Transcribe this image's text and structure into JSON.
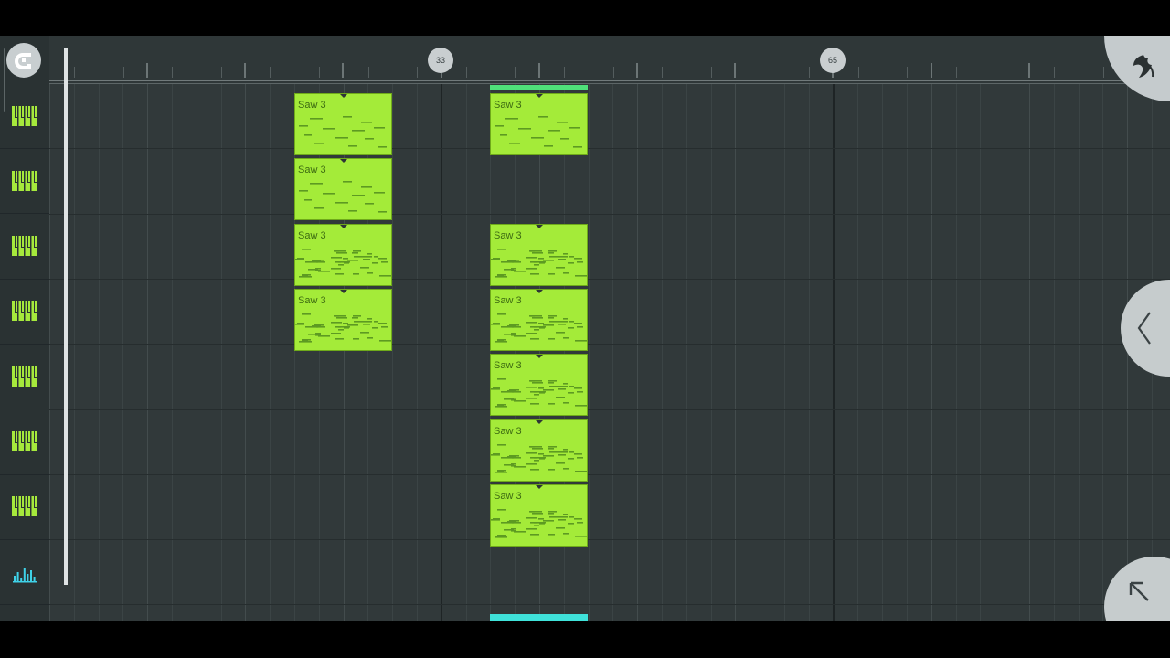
{
  "ruler": {
    "markers": [
      "33",
      "65"
    ]
  },
  "clip_label": "Saw 3",
  "tracks": [
    {
      "icon": "piano-keys-icon"
    },
    {
      "icon": "piano-keys-icon"
    },
    {
      "icon": "piano-keys-icon"
    },
    {
      "icon": "piano-keys-icon"
    },
    {
      "icon": "piano-keys-icon"
    },
    {
      "icon": "piano-keys-icon"
    },
    {
      "icon": "piano-keys-icon"
    },
    {
      "icon": "automation-icon"
    }
  ],
  "colors": {
    "clip": "#a4eb39",
    "clip_notes": "#5d9a22",
    "piano_icon": "#a6e93c",
    "automation_icon": "#3fd2e8",
    "selected": "#4fe07a"
  },
  "patterns": [
    {
      "label": "Saw 3"
    },
    {
      "label": "Saw 3"
    },
    {
      "label": "Saw 3"
    },
    {
      "label": "Saw 3"
    },
    {
      "label": "Saw 3"
    },
    {
      "label": "Saw 3"
    },
    {
      "label": "Saw 3"
    },
    {
      "label": "Saw 3"
    },
    {
      "label": "Saw 3"
    },
    {
      "label": "Saw 3"
    },
    {
      "label": "Saw 3"
    }
  ]
}
